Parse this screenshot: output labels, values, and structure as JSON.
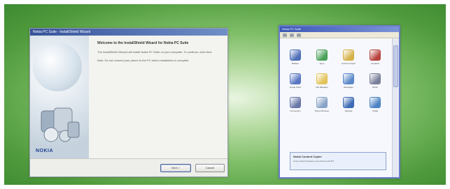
{
  "wizard": {
    "title": "Nokia PC Suite - InstallShield Wizard",
    "heading": "Welcome to the InstallShield Wizard for Nokia PC Suite",
    "intro": "The InstallShield Wizard will install Nokia PC Suite on your computer. To continue, click Next.",
    "note": "Note: Do not connect your phone to the PC before installation is complete.",
    "brand": "NOKIA",
    "next_button": "Next >",
    "cancel_button": "Cancel"
  },
  "explorer": {
    "title": "Nokia PC Suite",
    "icons": [
      {
        "label": "Backup",
        "icon": "backup-icon",
        "color": "#4f6fb8"
      },
      {
        "label": "Sync",
        "icon": "sync-icon",
        "color": "#4aa15a"
      },
      {
        "label": "Content Copier",
        "icon": "folder-icon",
        "color": "#d7b24b"
      },
      {
        "label": "Contacts",
        "icon": "contacts-icon",
        "color": "#b8433f"
      },
      {
        "label": "Image Store",
        "icon": "image-icon",
        "color": "#5a78c2"
      },
      {
        "label": "File Manager",
        "icon": "folder-icon",
        "color": "#e2c45a"
      },
      {
        "label": "Messages",
        "icon": "messages-icon",
        "color": "#5b88c9"
      },
      {
        "label": "Music",
        "icon": "music-icon",
        "color": "#7a7f9b"
      },
      {
        "label": "Connection",
        "icon": "connection-icon",
        "color": "#6a78a8"
      },
      {
        "label": "Phone Browser",
        "icon": "browser-icon",
        "color": "#8aa3c8"
      },
      {
        "label": "Settings",
        "icon": "settings-icon",
        "color": "#3d6ab5"
      },
      {
        "label": "Install",
        "icon": "install-icon",
        "color": "#4c84c4"
      }
    ],
    "info_title": "Nokia Content Copier",
    "info_desc": "Copy content between your phones and PC"
  },
  "colors": {
    "background_green": "#4f9a3c",
    "title_bar_blue": "#38539b"
  }
}
